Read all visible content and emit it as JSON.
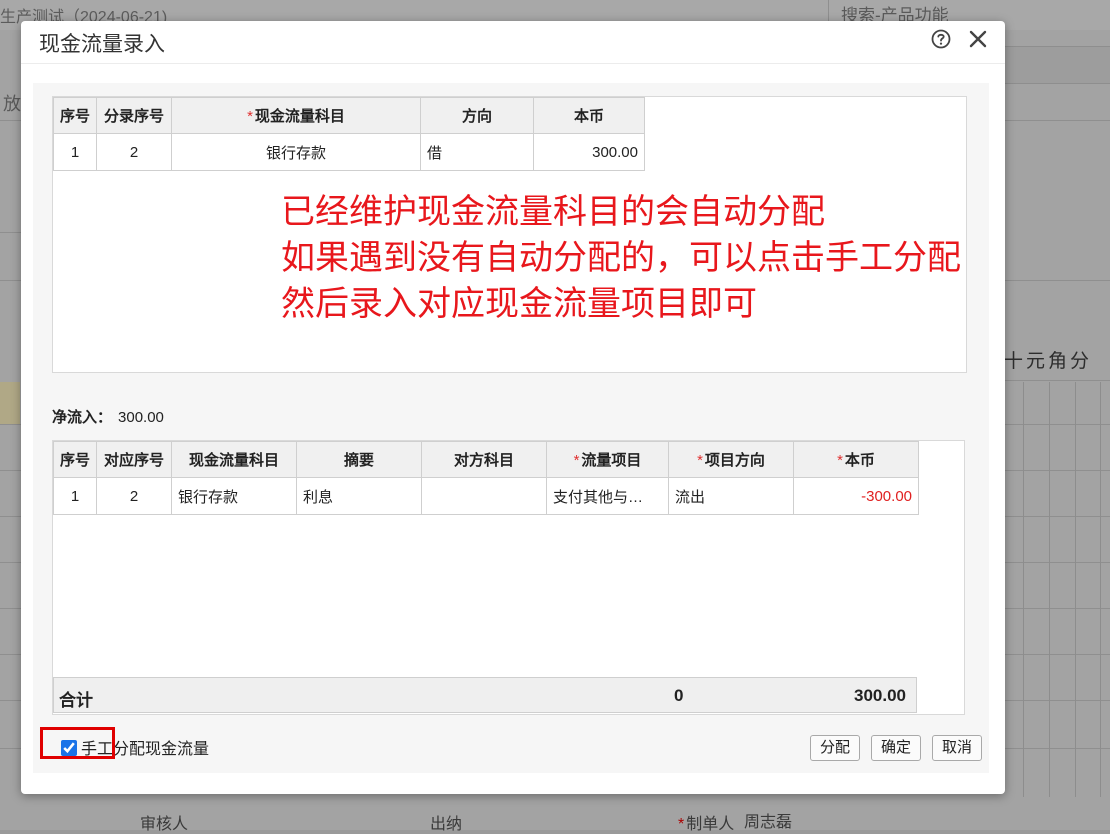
{
  "background": {
    "page_title": "生产测试（2024-06-21)",
    "search_label": "搜索-产品功能",
    "left_truncated": "放",
    "units": "十元角分",
    "footer": {
      "reviewer": "审核人",
      "cashier": "出纳",
      "maker_label": "制单人",
      "maker_name": "周志磊"
    }
  },
  "modal": {
    "title": "现金流量录入",
    "help_icon": "question-circle-icon",
    "close_icon": "close-icon"
  },
  "entry_table": {
    "headers": [
      "序号",
      "分录序号",
      "现金流量科目",
      "方向",
      "本币"
    ],
    "required_mark": "*",
    "rows": [
      {
        "seq": "1",
        "entry_seq": "2",
        "account": "银行存款",
        "direction": "借",
        "amount": "300.00"
      }
    ]
  },
  "annotation": {
    "line1": "已经维护现金流量科目的会自动分配",
    "line2": "如果遇到没有自动分配的，可以点击手工分配",
    "line3": "然后录入对应现金流量项目即可"
  },
  "net_flow": {
    "label": "净流入：",
    "value": "300.00"
  },
  "alloc_table": {
    "headers": [
      "序号",
      "对应序号",
      "现金流量科目",
      "摘要",
      "对方科目",
      "流量项目",
      "项目方向",
      "本币"
    ],
    "rows": [
      {
        "seq": "1",
        "ref_seq": "2",
        "account": "银行存款",
        "summary": "利息",
        "counter": "",
        "flow_item": "支付其他与…",
        "item_direction": "流出",
        "amount": "-300.00"
      }
    ],
    "total": {
      "label": "合计",
      "zero": "0",
      "sum": "300.00"
    }
  },
  "footer": {
    "manual_label": "手工分配现金流量",
    "manual_checked": true,
    "buttons": {
      "allocate": "分配",
      "confirm": "确定",
      "cancel": "取消"
    }
  },
  "colors": {
    "annotation": "#e8171c",
    "required": "#e03030",
    "negative": "#e02020",
    "highlight_box": "#e00000",
    "checkbox": "#1a73e8"
  }
}
